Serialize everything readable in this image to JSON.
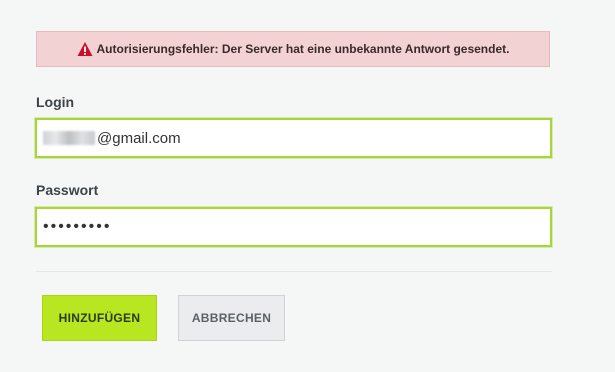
{
  "alert": {
    "icon": "warning-icon",
    "text": "Autorisierungsfehler: Der Server hat eine unbekannte Antwort gesendet."
  },
  "form": {
    "login_label": "Login",
    "login_value_visible": "@gmail.com",
    "password_label": "Passwort",
    "password_masked": "•••••••••"
  },
  "buttons": {
    "add_label": "HINZUFÜGEN",
    "cancel_label": "ABBRECHEN"
  },
  "colors": {
    "accent": "#b8e621",
    "alert_bg": "#f3d2d3",
    "warning_icon": "#c8102e"
  }
}
